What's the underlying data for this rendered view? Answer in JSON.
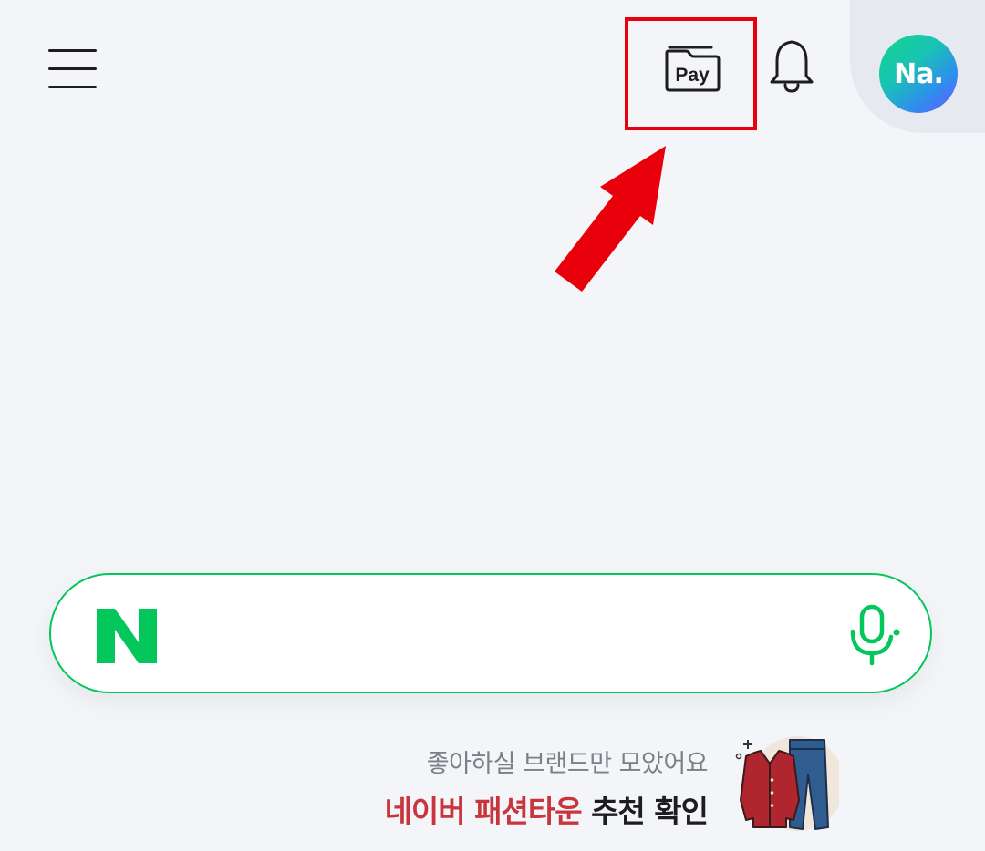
{
  "header": {
    "menu_icon": "hamburger-menu-icon",
    "pay_label": "Pay",
    "pay_icon": "naver-pay-wallet-icon",
    "notification_icon": "bell-icon",
    "avatar_text": "Na."
  },
  "search": {
    "logo_text": "N",
    "logo_color": "#03c75a",
    "placeholder": "",
    "mic_icon": "microphone-icon",
    "accent_color": "#03c75a"
  },
  "promo": {
    "subtitle": "좋아하실 브랜드만 모았어요",
    "brand": "네이버 패션타운",
    "action": " 추천 확인",
    "brand_color": "#c9353d",
    "illustration": "clothing-cardigan-jeans-illustration"
  },
  "annotation": {
    "box_color": "#e8000b",
    "arrow_color": "#e8000b"
  }
}
